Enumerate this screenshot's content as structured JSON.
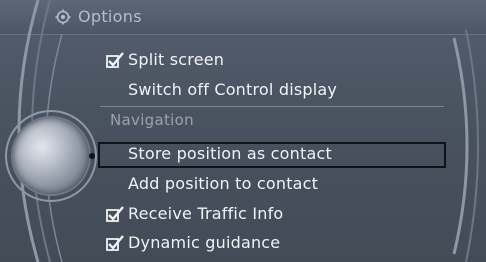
{
  "header": {
    "title": "Options",
    "icon": "settings-gear-icon"
  },
  "menu": {
    "items": [
      {
        "label": "Split screen",
        "checked": true
      },
      {
        "label": "Switch off Control display",
        "checked": false
      }
    ],
    "section": "Navigation",
    "nav_items": [
      {
        "label": "Store position as contact",
        "checked": false,
        "focused": true
      },
      {
        "label": "Add position to contact",
        "checked": false
      },
      {
        "label": "Receive Traffic Info",
        "checked": true
      },
      {
        "label": "Dynamic guidance",
        "checked": true
      }
    ]
  },
  "colors": {
    "background": "#4b5461",
    "text": "#f1f3f6",
    "section_text": "#9aa2af",
    "focus_border": "#101317"
  }
}
